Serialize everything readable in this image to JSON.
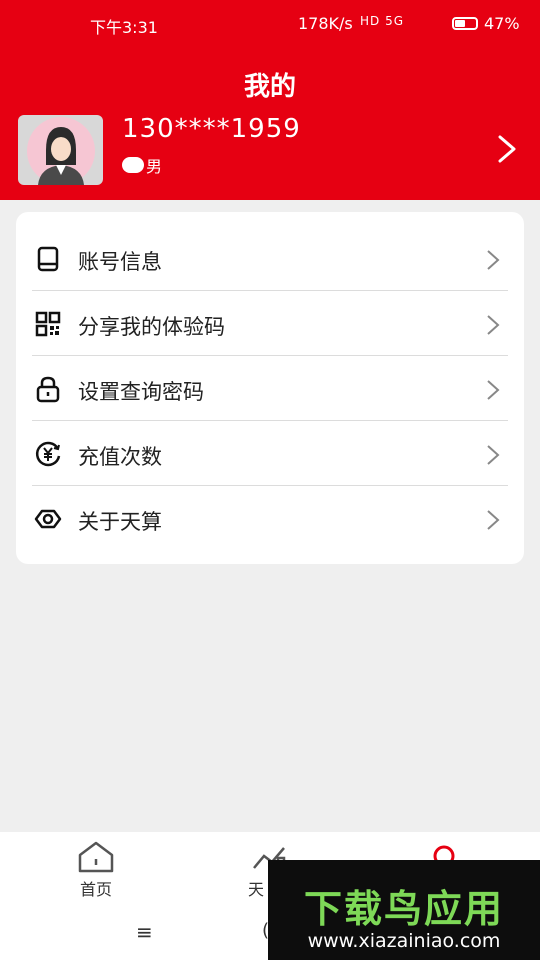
{
  "status_bar": {
    "time": "下午3:31",
    "speed": "178K/s",
    "network": "HD 5G",
    "battery": "47%"
  },
  "colors": {
    "accent": "#e60012",
    "background": "#efefef"
  },
  "header": {
    "title": "我的",
    "phone": "130****1959",
    "gender": "男",
    "avatar_icon": "female-avatar-icon"
  },
  "menu": {
    "items": [
      {
        "label": "账号信息",
        "icon": "tablet-icon"
      },
      {
        "label": "分享我的体验码",
        "icon": "qr-code-icon"
      },
      {
        "label": "设置查询密码",
        "icon": "lock-icon"
      },
      {
        "label": "充值次数",
        "icon": "yuan-recharge-icon"
      },
      {
        "label": "关于天算",
        "icon": "eye-icon"
      }
    ]
  },
  "bottom_nav": {
    "items": [
      {
        "label": "首页",
        "icon": "home-icon"
      },
      {
        "label": "天",
        "icon": "trend-icon"
      },
      {
        "label": "",
        "icon": "profile-icon"
      }
    ]
  },
  "system_nav": {
    "menu": "≡",
    "home": "("
  },
  "watermark": {
    "logo": "下载鸟应用",
    "url": "www.xiazainiao.com"
  }
}
